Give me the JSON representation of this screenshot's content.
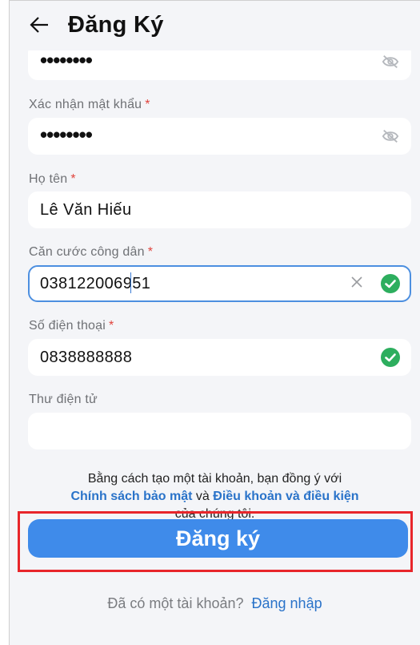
{
  "header": {
    "title": "Đăng Ký",
    "back_icon": "arrow-left-icon"
  },
  "fields": {
    "password": {
      "value": "••••••••",
      "icon": "eye-off-icon"
    },
    "confirm_password": {
      "label": "Xác nhận mật khẩu",
      "required_mark": "*",
      "value": "••••••••",
      "icon": "eye-off-icon"
    },
    "full_name": {
      "label": "Họ tên",
      "required_mark": "*",
      "value": "Lê Văn Hiếu"
    },
    "citizen_id": {
      "label": "Căn cước công dân",
      "required_mark": "*",
      "value": "038122006951",
      "focused": true,
      "icons": [
        "clear-icon",
        "check-circle-icon"
      ]
    },
    "phone": {
      "label": "Số điện thoại",
      "required_mark": "*",
      "value": "0838888888",
      "icon": "check-circle-icon"
    },
    "email": {
      "label": "Thư điện tử",
      "value": ""
    }
  },
  "terms": {
    "line1": "Bằng cách tạo một tài khoản, bạn đồng ý với",
    "privacy_link": "Chính sách bảo mật",
    "and": "và",
    "terms_link": "Điều khoản và điều kiện",
    "line3": "của chúng tôi."
  },
  "submit": {
    "label": "Đăng ký"
  },
  "login": {
    "prompt": "Đã có một tài khoản?",
    "link": "Đăng nhập"
  },
  "colors": {
    "accent": "#3f8bea",
    "link": "#2a73c9",
    "check": "#2dae5e",
    "required": "#e0443d",
    "highlight_box": "#e8262b",
    "background": "#f4f5f8"
  }
}
